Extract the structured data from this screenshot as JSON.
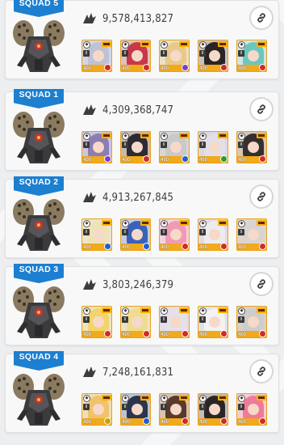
{
  "squads": [
    {
      "label": "SQUAD 1",
      "score": "4,309,368,747",
      "cards": [
        {
          "hair": "#8c7db3",
          "bg": "#cfc5e0",
          "element": "#7b3fd0"
        },
        {
          "hair": "#2d2a33",
          "bg": "#c9b9b0",
          "element": "#d12a2a"
        },
        {
          "hair": "#c9c8cc",
          "bg": "#d8d6d0",
          "element": "#1d5fd0"
        },
        {
          "hair": "#e3dfe8",
          "bg": "#dcd8e2",
          "element": "#1f9d3a"
        },
        {
          "hair": "#35302f",
          "bg": "#d8c7b5",
          "element": "#d12a2a"
        }
      ]
    },
    {
      "label": "SQUAD 2",
      "score": "4,913,267,845",
      "cards": [
        {
          "hair": "#f0e2b8",
          "bg": "#efe4cc",
          "element": "#1d5fd0"
        },
        {
          "hair": "#3b62b8",
          "bg": "#c3cbe6",
          "element": "#1d5fd0"
        },
        {
          "hair": "#f29ab5",
          "bg": "#f4d3dc",
          "element": "#d12a2a"
        },
        {
          "hair": "#ececee",
          "bg": "#e8d6e2",
          "element": "#d12a2a"
        },
        {
          "hair": "#d8d4d4",
          "bg": "#e2d3cf",
          "element": "#d12a2a"
        }
      ]
    },
    {
      "label": "SQUAD 3",
      "score": "3,803,246,379",
      "cards": [
        {
          "hair": "#f2d46a",
          "bg": "#efe2bd",
          "element": "#d12a2a"
        },
        {
          "hair": "#f0dc8e",
          "bg": "#eae3c9",
          "element": "#d12a2a"
        },
        {
          "hair": "#e6e0ea",
          "bg": "#e6dde6",
          "element": "#d12a2a"
        },
        {
          "hair": "#f2f2f2",
          "bg": "#dfe2e6",
          "element": "#d12a2a"
        },
        {
          "hair": "#cfcccc",
          "bg": "#d9d0cc",
          "element": "#d12a2a"
        }
      ]
    },
    {
      "label": "SQUAD 4",
      "score": "7,248,161,831",
      "cards": [
        {
          "hair": "#f0c36a",
          "bg": "#efdfb8",
          "element": "#c9a400"
        },
        {
          "hair": "#2c3550",
          "bg": "#bcc3d6",
          "element": "#1d5fd0"
        },
        {
          "hair": "#5a3a2a",
          "bg": "#d9c3ae",
          "element": "#d12a2a"
        },
        {
          "hair": "#2a2626",
          "bg": "#c9bcb4",
          "element": "#d12a2a"
        },
        {
          "hair": "#f07a9a",
          "bg": "#f2cdd6",
          "element": "#d12a2a"
        }
      ]
    },
    {
      "label": "SQUAD 5",
      "score": "9,578,413,827",
      "cards": [
        {
          "hair": "#bfc1d6",
          "bg": "#d6d6e2",
          "element": "#d12a2a"
        },
        {
          "hair": "#c8384a",
          "bg": "#e2bfc2",
          "element": "#d12a2a"
        },
        {
          "hair": "#e8c98a",
          "bg": "#ece0c3",
          "element": "#7b3fd0"
        },
        {
          "hair": "#2a2424",
          "bg": "#cdbfb8",
          "element": "#d12a2a"
        },
        {
          "hair": "#6cc6c0",
          "bg": "#cfe6e4",
          "element": "#d12a2a"
        }
      ]
    }
  ],
  "icons": {
    "damage": "damage-icon",
    "link": "link-icon"
  },
  "colors": {
    "squad_tag": "#1c7fd0",
    "card_frame": "#e7a11c"
  }
}
